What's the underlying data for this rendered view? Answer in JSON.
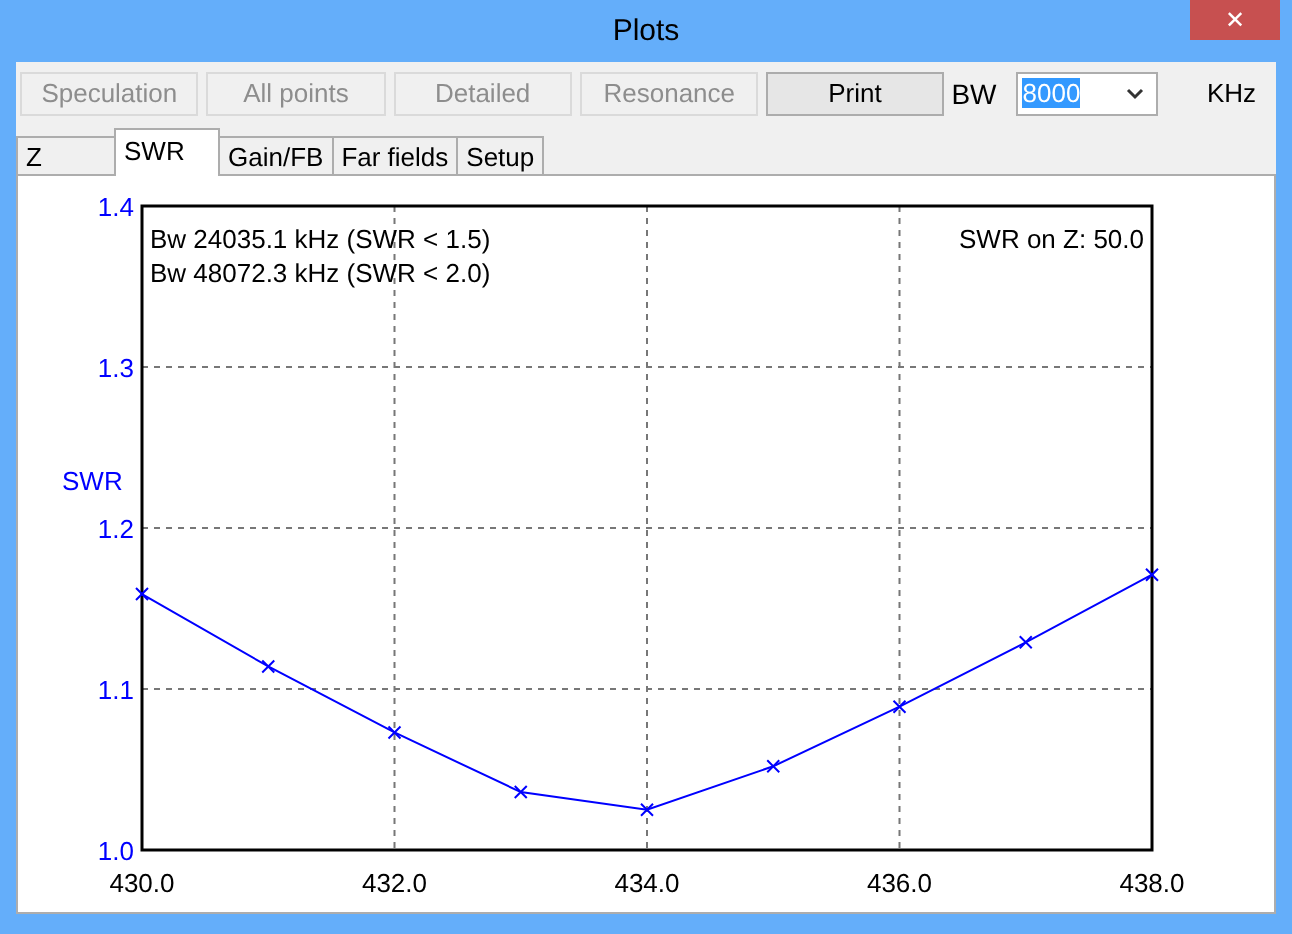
{
  "window": {
    "title": "Plots",
    "close": "✕"
  },
  "buttons": [
    {
      "label": "Speculation",
      "disabled": true
    },
    {
      "label": "All points",
      "disabled": true
    },
    {
      "label": "Detailed",
      "disabled": true
    },
    {
      "label": "Resonance",
      "disabled": true
    },
    {
      "label": "Print",
      "disabled": false
    }
  ],
  "bw": {
    "label": "BW",
    "value": "8000",
    "unit": "KHz"
  },
  "tabs": [
    {
      "label": "Z",
      "selected": false
    },
    {
      "label": "SWR",
      "selected": true
    },
    {
      "label": "Gain/FB",
      "selected": false
    },
    {
      "label": "Far fields",
      "selected": false
    },
    {
      "label": "Setup",
      "selected": false
    }
  ],
  "plot": {
    "notes": [
      "Bw 24035.1 kHz (SWR < 1.5)",
      "Bw 48072.3 kHz (SWR < 2.0)"
    ],
    "reference": "SWR on Z: 50.0",
    "chart_data": {
      "type": "line",
      "ylabel": "SWR",
      "x": [
        430,
        431,
        432,
        433,
        434,
        435,
        436,
        437,
        438
      ],
      "grid": true,
      "series": [
        {
          "color": "#0000ff",
          "marker": "x",
          "values": [
            1.159,
            1.114,
            1.073,
            1.036,
            1.025,
            1.052,
            1.089,
            1.129,
            1.171
          ]
        }
      ],
      "xlim": [
        430,
        438
      ],
      "ylim": [
        1.0,
        1.4
      ],
      "xticks": [
        {
          "value": 430,
          "label": "430.0"
        },
        {
          "value": 432,
          "label": "432.0"
        },
        {
          "value": 434,
          "label": "434.0"
        },
        {
          "value": 436,
          "label": "436.0"
        },
        {
          "value": 438,
          "label": "438.0"
        }
      ],
      "yticks": [
        {
          "value": 1.0,
          "label": "1.0"
        },
        {
          "value": 1.1,
          "label": "1.1"
        },
        {
          "value": 1.2,
          "label": "1.2"
        },
        {
          "value": 1.3,
          "label": "1.3"
        },
        {
          "value": 1.4,
          "label": "1.4"
        }
      ]
    }
  }
}
